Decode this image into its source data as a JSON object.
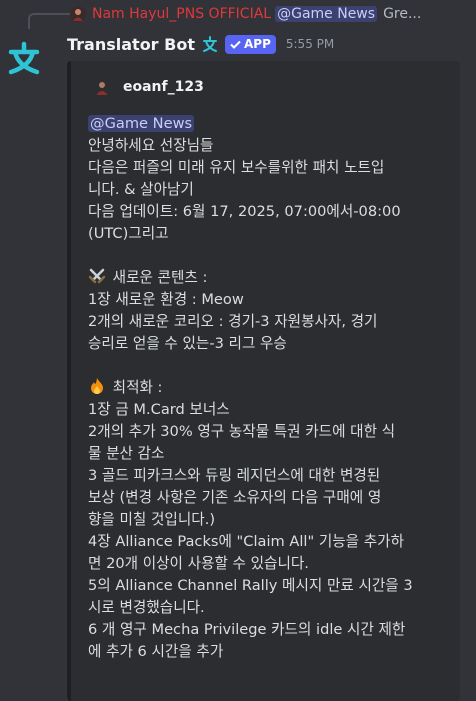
{
  "reply": {
    "author": "Nam Hayul_PNS OFFICIAL",
    "mention": "@Game News",
    "text": "Gre..."
  },
  "message": {
    "username": "Translator Bot",
    "app_badge": "APP",
    "timestamp": "5:55 PM"
  },
  "embed": {
    "author": "eoanf_123",
    "mention": "@Game News",
    "lines": [
      "안녕하세요 선장님들",
      "다음은 퍼즐의 미래 유지 보수를위한 패치 노트입",
      "니다. & 살아남기",
      "다음 업데이트: 6월 17, 2025, 07:00에서-08:00",
      "(UTC)그리고",
      "",
      "새로운 콘텐츠 :",
      "1장 새로운 환경 : Meow",
      "2개의 새로운 코리오 : 경기-3 자원봉사자, 경기",
      "승리로 얻을 수 있는-3 리그 우승",
      "",
      "최적화 :",
      "1장 금 M.Card 보너스",
      "2개의 추가 30% 영구 농작물 특권 카드에 대한 식",
      "물 분산 감소",
      "3 골드 피카크스와 듀링 레지던스에 대한 변경된",
      "보상 (변경 사항은 기존 소유자의 다음 구매에 영",
      "향을 미칠 것입니다.)",
      "4장 Alliance Packs에 \"Claim All\" 기능을 추가하",
      "면 20개 이상이 사용할 수 있습니다.",
      "5의 Alliance Channel Rally 메시지 만료 시간을 3",
      "시로 변경했습니다.",
      "6 개 영구 Mecha Privilege 카드의 idle 시간 제한",
      "에 추가 6 시간을 추가"
    ]
  },
  "icons": {
    "bot_avatar": "translate-icon",
    "sword_emoji": "crossed-swords-icon",
    "fire_emoji": "fire-icon",
    "verified": "checkmark-icon"
  },
  "colors": {
    "background": "#313338",
    "embed_bg": "#2b2d31",
    "accent_teal": "#2ec4d6",
    "badge": "#5865f2",
    "reply_author": "#e0383b"
  }
}
